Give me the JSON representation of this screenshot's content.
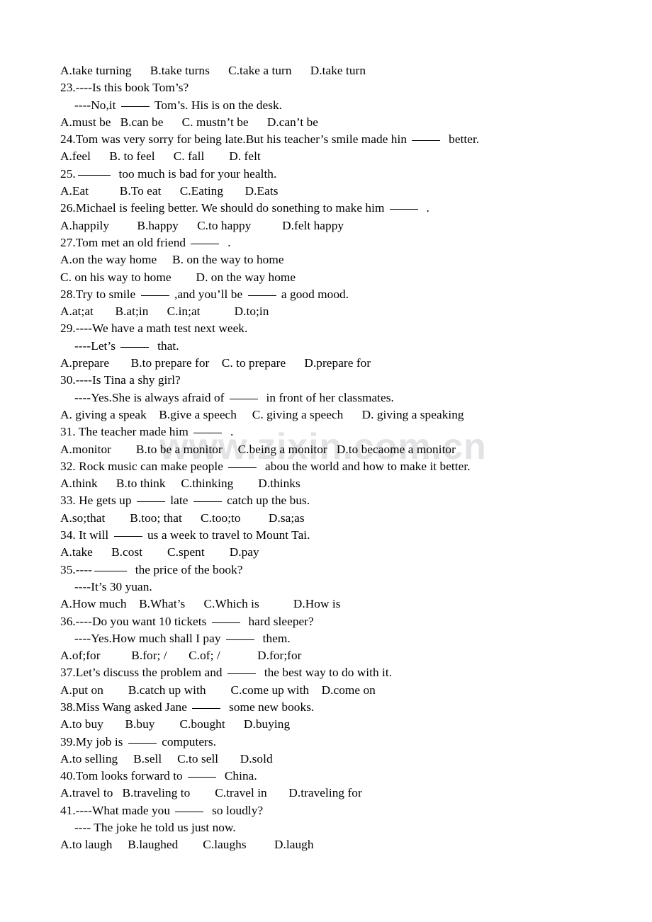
{
  "document": {
    "type": "english-grammar-multiple-choice-worksheet",
    "watermark": "www.zixin.com.cn",
    "lines": [
      {
        "id": "l01",
        "kind": "options",
        "text": "A.take turning      B.take turns      C.take a turn      D.take turn"
      },
      {
        "id": "l02",
        "kind": "question",
        "text": "23.----Is this book Tom’s?"
      },
      {
        "id": "l03",
        "kind": "dialogue",
        "indent": true,
        "pre": "----No,it ",
        "blank": "w1",
        "post": " Tom’s. His is on the desk."
      },
      {
        "id": "l04",
        "kind": "options",
        "text": "A.must be   B.can be      C. mustn’t be      D.can’t be"
      },
      {
        "id": "l05",
        "kind": "question",
        "pre": "24.Tom was very sorry for being late.But his teacher’s smile made hin ",
        "blank": "w1",
        "post": "  better."
      },
      {
        "id": "l06",
        "kind": "options",
        "text": "A.feel      B. to feel      C. fall        D. felt"
      },
      {
        "id": "l07",
        "kind": "question",
        "pre": "25.",
        "blank": "w2",
        "post": "  too much is bad for your health."
      },
      {
        "id": "l08",
        "kind": "options",
        "text": "A.Eat          B.To eat      C.Eating       D.Eats"
      },
      {
        "id": "l09",
        "kind": "question",
        "pre": "26.Michael is feeling better. We should do sonething to make him ",
        "blank": "w1",
        "post": "  ."
      },
      {
        "id": "l10",
        "kind": "options",
        "text": "A.happily         B.happy      C.to happy          D.felt happy"
      },
      {
        "id": "l11",
        "kind": "question",
        "pre": "27.Tom met an old friend ",
        "blank": "w1",
        "post": "  ."
      },
      {
        "id": "l12",
        "kind": "options",
        "text": "A.on the way home     B. on the way to home"
      },
      {
        "id": "l13",
        "kind": "options",
        "text": "C. on his way to home        D. on the way home"
      },
      {
        "id": "l14",
        "kind": "question",
        "pre": "28.Try to smile ",
        "blank": "w1",
        "mid": " ,and you’ll be ",
        "blank2": "w1",
        "post": " a good mood."
      },
      {
        "id": "l15",
        "kind": "options",
        "text": "A.at;at       B.at;in      C.in;at           D.to;in"
      },
      {
        "id": "l16",
        "kind": "question",
        "text": "29.----We have a math test next week."
      },
      {
        "id": "l17",
        "kind": "dialogue",
        "indent": true,
        "pre": "----Let’s ",
        "blank": "w1",
        "post": "  that."
      },
      {
        "id": "l18",
        "kind": "options",
        "text": "A.prepare       B.to prepare for    C. to prepare      D.prepare for"
      },
      {
        "id": "l19",
        "kind": "question",
        "text": "30.----Is Tina a shy girl?"
      },
      {
        "id": "l20",
        "kind": "dialogue",
        "indent": true,
        "pre": "----Yes.She is always afraid of ",
        "blank": "w1",
        "post": "  in front of her classmates."
      },
      {
        "id": "l21",
        "kind": "options",
        "text": "A. giving a speak    B.give a speech     C. giving a speech      D. giving a speaking"
      },
      {
        "id": "l22",
        "kind": "question",
        "pre": "31. The teacher made him ",
        "blank": "w1",
        "post": "  ."
      },
      {
        "id": "l23",
        "kind": "options",
        "text": "A.monitor        B.to be a monitor     C.being a monitor   D.to becaome a monitor"
      },
      {
        "id": "l24",
        "kind": "question",
        "pre": "32. Rock music can make people ",
        "blank": "w1",
        "post": "  abou the world and how to make it better."
      },
      {
        "id": "l25",
        "kind": "options",
        "text": "A.think      B.to think     C.thinking        D.thinks"
      },
      {
        "id": "l26",
        "kind": "question",
        "pre": "33. He gets up ",
        "blank": "w1",
        "mid": " late ",
        "blank2": "w1",
        "post": " catch up the bus."
      },
      {
        "id": "l27",
        "kind": "options",
        "text": "A.so;that        B.too; that      C.too;to         D.sa;as"
      },
      {
        "id": "l28",
        "kind": "question",
        "pre": "34. It will ",
        "blank": "w1",
        "post": " us a week to travel to Mount Tai."
      },
      {
        "id": "l29",
        "kind": "options",
        "text": "A.take      B.cost        C.spent        D.pay"
      },
      {
        "id": "l30",
        "kind": "question",
        "pre": "35.----",
        "blank": "w2",
        "post": "  the price of the book?"
      },
      {
        "id": "l31",
        "kind": "dialogue",
        "indent": true,
        "text": "----It’s 30 yuan."
      },
      {
        "id": "l32",
        "kind": "options",
        "text": "A.How much    B.What’s      C.Which is           D.How is"
      },
      {
        "id": "l33",
        "kind": "question",
        "pre": "36.----Do you want 10 tickets ",
        "blank": "w1",
        "post": "  hard sleeper?"
      },
      {
        "id": "l34",
        "kind": "dialogue",
        "indent": true,
        "pre": "----Yes.How much shall I pay ",
        "blank": "w1",
        "post": "  them."
      },
      {
        "id": "l35",
        "kind": "options",
        "text": "A.of;for          B.for; /       C.of; /            D.for;for"
      },
      {
        "id": "l36",
        "kind": "question",
        "pre": "37.Let’s discuss the problem and ",
        "blank": "w1",
        "post": "  the best way to do with it."
      },
      {
        "id": "l37",
        "kind": "options",
        "text": "A.put on        B.catch up with        C.come up with    D.come on"
      },
      {
        "id": "l38",
        "kind": "question",
        "pre": "38.Miss Wang asked Jane ",
        "blank": "w1",
        "post": "  some new books."
      },
      {
        "id": "l39",
        "kind": "options",
        "text": "A.to buy       B.buy        C.bought      D.buying"
      },
      {
        "id": "l40",
        "kind": "question",
        "pre": "39.My job is ",
        "blank": "w1",
        "post": " computers."
      },
      {
        "id": "l41",
        "kind": "options",
        "text": "A.to selling     B.sell     C.to sell       D.sold"
      },
      {
        "id": "l42",
        "kind": "question",
        "pre": "40.Tom looks forward to ",
        "blank": "w1",
        "post": "  China."
      },
      {
        "id": "l43",
        "kind": "options",
        "text": "A.travel to   B.traveling to        C.travel in       D.traveling for"
      },
      {
        "id": "l44",
        "kind": "question",
        "pre": "41.----What made you ",
        "blank": "w1",
        "post": "  so loudly?"
      },
      {
        "id": "l45",
        "kind": "dialogue",
        "indent": true,
        "text": "---- The joke he told us just now."
      },
      {
        "id": "l46",
        "kind": "options",
        "text": "A.to laugh     B.laughed        C.laughs         D.laugh"
      }
    ]
  }
}
